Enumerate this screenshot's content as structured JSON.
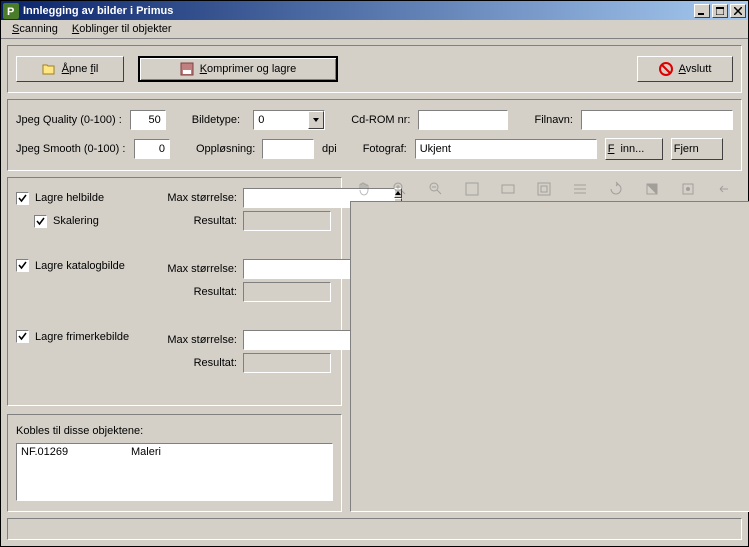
{
  "window": {
    "title": "Innlegging av bilder i Primus"
  },
  "menu": {
    "scanning": "Scanning",
    "koblinger": "Koblinger til objekter"
  },
  "toolbar": {
    "open": "Åpne fil",
    "compress": "Komprimer og lagre",
    "exit": "Avslutt"
  },
  "settings": {
    "jpeg_quality_label": "Jpeg Quality (0-100) :",
    "jpeg_quality_value": "50",
    "bildetype_label": "Bildetype:",
    "bildetype_value": "0",
    "cdrom_label": "Cd-ROM nr:",
    "cdrom_value": "",
    "filnavn_label": "Filnavn:",
    "filnavn_value": "",
    "jpeg_smooth_label": "Jpeg Smooth (0-100) :",
    "jpeg_smooth_value": "0",
    "opplosning_label": "Oppløsning:",
    "opplosning_value": "",
    "dpi": "dpi",
    "fotograf_label": "Fotograf:",
    "fotograf_value": "Ukjent",
    "finn": "Finn...",
    "fjern": "Fjern"
  },
  "options": {
    "lagre_helbilde": "Lagre helbilde",
    "skalering": "Skalering",
    "lagre_katalogbilde": "Lagre katalogbilde",
    "lagre_frimerkebilde": "Lagre frimerkebilde",
    "max_storrelse": "Max størrelse:",
    "resultat": "Resultat:"
  },
  "link": {
    "label": "Kobles til disse objektene:",
    "items": [
      {
        "id": "NF.01269",
        "type": "Maleri"
      }
    ]
  }
}
